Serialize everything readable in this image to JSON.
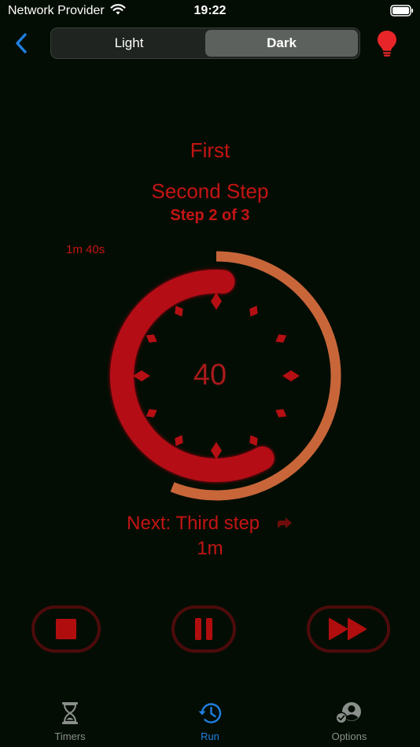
{
  "status_bar": {
    "carrier": "Network Provider",
    "time": "19:22"
  },
  "header": {
    "segments": [
      {
        "label": "Light",
        "selected": false
      },
      {
        "label": "Dark",
        "selected": true
      }
    ]
  },
  "run": {
    "timer_name": "First",
    "step_name": "Second Step",
    "step_count": "Step 2 of 3",
    "total_remaining": "1m 40s",
    "step_remaining": "40",
    "step_progress": 0.67,
    "total_progress": 0.56,
    "next_label": "Next: Third step",
    "next_duration": "1m"
  },
  "controls": {
    "stop": "stop-icon",
    "pause": "pause-icon",
    "skip": "fast-forward-icon"
  },
  "tabs": [
    {
      "label": "Timers",
      "icon": "hourglass-icon",
      "active": false
    },
    {
      "label": "Run",
      "icon": "clock-history-icon",
      "active": true
    },
    {
      "label": "Options",
      "icon": "profile-settings-icon",
      "active": false
    }
  ],
  "colors": {
    "background": "#040d04",
    "red": "#c41414",
    "ring_orange": "#c8663a",
    "accent_blue": "#1f7fe0"
  }
}
